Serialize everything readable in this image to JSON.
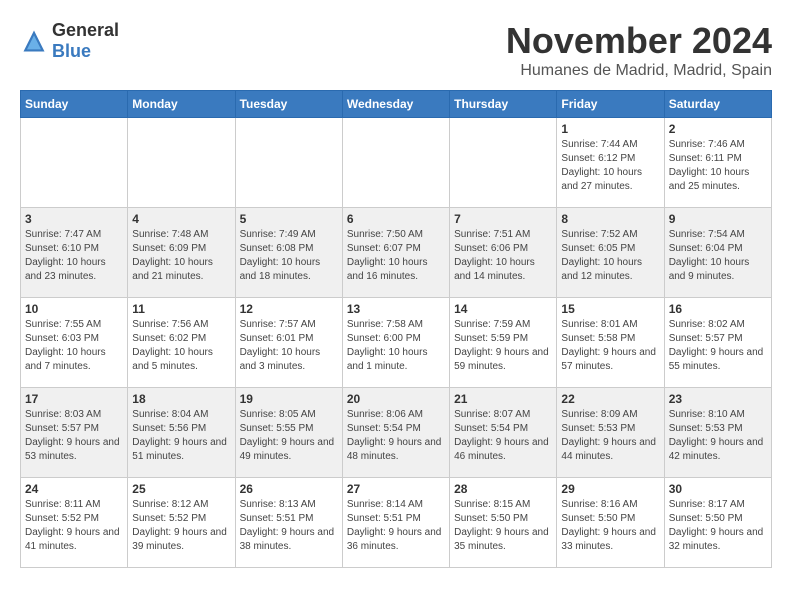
{
  "header": {
    "logo_general": "General",
    "logo_blue": "Blue",
    "title": "November 2024",
    "subtitle": "Humanes de Madrid, Madrid, Spain"
  },
  "weekdays": [
    "Sunday",
    "Monday",
    "Tuesday",
    "Wednesday",
    "Thursday",
    "Friday",
    "Saturday"
  ],
  "weeks": [
    [
      {
        "day": "",
        "sunrise": "",
        "sunset": "",
        "daylight": ""
      },
      {
        "day": "",
        "sunrise": "",
        "sunset": "",
        "daylight": ""
      },
      {
        "day": "",
        "sunrise": "",
        "sunset": "",
        "daylight": ""
      },
      {
        "day": "",
        "sunrise": "",
        "sunset": "",
        "daylight": ""
      },
      {
        "day": "",
        "sunrise": "",
        "sunset": "",
        "daylight": ""
      },
      {
        "day": "1",
        "sunrise": "Sunrise: 7:44 AM",
        "sunset": "Sunset: 6:12 PM",
        "daylight": "Daylight: 10 hours and 27 minutes."
      },
      {
        "day": "2",
        "sunrise": "Sunrise: 7:46 AM",
        "sunset": "Sunset: 6:11 PM",
        "daylight": "Daylight: 10 hours and 25 minutes."
      }
    ],
    [
      {
        "day": "3",
        "sunrise": "Sunrise: 7:47 AM",
        "sunset": "Sunset: 6:10 PM",
        "daylight": "Daylight: 10 hours and 23 minutes."
      },
      {
        "day": "4",
        "sunrise": "Sunrise: 7:48 AM",
        "sunset": "Sunset: 6:09 PM",
        "daylight": "Daylight: 10 hours and 21 minutes."
      },
      {
        "day": "5",
        "sunrise": "Sunrise: 7:49 AM",
        "sunset": "Sunset: 6:08 PM",
        "daylight": "Daylight: 10 hours and 18 minutes."
      },
      {
        "day": "6",
        "sunrise": "Sunrise: 7:50 AM",
        "sunset": "Sunset: 6:07 PM",
        "daylight": "Daylight: 10 hours and 16 minutes."
      },
      {
        "day": "7",
        "sunrise": "Sunrise: 7:51 AM",
        "sunset": "Sunset: 6:06 PM",
        "daylight": "Daylight: 10 hours and 14 minutes."
      },
      {
        "day": "8",
        "sunrise": "Sunrise: 7:52 AM",
        "sunset": "Sunset: 6:05 PM",
        "daylight": "Daylight: 10 hours and 12 minutes."
      },
      {
        "day": "9",
        "sunrise": "Sunrise: 7:54 AM",
        "sunset": "Sunset: 6:04 PM",
        "daylight": "Daylight: 10 hours and 9 minutes."
      }
    ],
    [
      {
        "day": "10",
        "sunrise": "Sunrise: 7:55 AM",
        "sunset": "Sunset: 6:03 PM",
        "daylight": "Daylight: 10 hours and 7 minutes."
      },
      {
        "day": "11",
        "sunrise": "Sunrise: 7:56 AM",
        "sunset": "Sunset: 6:02 PM",
        "daylight": "Daylight: 10 hours and 5 minutes."
      },
      {
        "day": "12",
        "sunrise": "Sunrise: 7:57 AM",
        "sunset": "Sunset: 6:01 PM",
        "daylight": "Daylight: 10 hours and 3 minutes."
      },
      {
        "day": "13",
        "sunrise": "Sunrise: 7:58 AM",
        "sunset": "Sunset: 6:00 PM",
        "daylight": "Daylight: 10 hours and 1 minute."
      },
      {
        "day": "14",
        "sunrise": "Sunrise: 7:59 AM",
        "sunset": "Sunset: 5:59 PM",
        "daylight": "Daylight: 9 hours and 59 minutes."
      },
      {
        "day": "15",
        "sunrise": "Sunrise: 8:01 AM",
        "sunset": "Sunset: 5:58 PM",
        "daylight": "Daylight: 9 hours and 57 minutes."
      },
      {
        "day": "16",
        "sunrise": "Sunrise: 8:02 AM",
        "sunset": "Sunset: 5:57 PM",
        "daylight": "Daylight: 9 hours and 55 minutes."
      }
    ],
    [
      {
        "day": "17",
        "sunrise": "Sunrise: 8:03 AM",
        "sunset": "Sunset: 5:57 PM",
        "daylight": "Daylight: 9 hours and 53 minutes."
      },
      {
        "day": "18",
        "sunrise": "Sunrise: 8:04 AM",
        "sunset": "Sunset: 5:56 PM",
        "daylight": "Daylight: 9 hours and 51 minutes."
      },
      {
        "day": "19",
        "sunrise": "Sunrise: 8:05 AM",
        "sunset": "Sunset: 5:55 PM",
        "daylight": "Daylight: 9 hours and 49 minutes."
      },
      {
        "day": "20",
        "sunrise": "Sunrise: 8:06 AM",
        "sunset": "Sunset: 5:54 PM",
        "daylight": "Daylight: 9 hours and 48 minutes."
      },
      {
        "day": "21",
        "sunrise": "Sunrise: 8:07 AM",
        "sunset": "Sunset: 5:54 PM",
        "daylight": "Daylight: 9 hours and 46 minutes."
      },
      {
        "day": "22",
        "sunrise": "Sunrise: 8:09 AM",
        "sunset": "Sunset: 5:53 PM",
        "daylight": "Daylight: 9 hours and 44 minutes."
      },
      {
        "day": "23",
        "sunrise": "Sunrise: 8:10 AM",
        "sunset": "Sunset: 5:53 PM",
        "daylight": "Daylight: 9 hours and 42 minutes."
      }
    ],
    [
      {
        "day": "24",
        "sunrise": "Sunrise: 8:11 AM",
        "sunset": "Sunset: 5:52 PM",
        "daylight": "Daylight: 9 hours and 41 minutes."
      },
      {
        "day": "25",
        "sunrise": "Sunrise: 8:12 AM",
        "sunset": "Sunset: 5:52 PM",
        "daylight": "Daylight: 9 hours and 39 minutes."
      },
      {
        "day": "26",
        "sunrise": "Sunrise: 8:13 AM",
        "sunset": "Sunset: 5:51 PM",
        "daylight": "Daylight: 9 hours and 38 minutes."
      },
      {
        "day": "27",
        "sunrise": "Sunrise: 8:14 AM",
        "sunset": "Sunset: 5:51 PM",
        "daylight": "Daylight: 9 hours and 36 minutes."
      },
      {
        "day": "28",
        "sunrise": "Sunrise: 8:15 AM",
        "sunset": "Sunset: 5:50 PM",
        "daylight": "Daylight: 9 hours and 35 minutes."
      },
      {
        "day": "29",
        "sunrise": "Sunrise: 8:16 AM",
        "sunset": "Sunset: 5:50 PM",
        "daylight": "Daylight: 9 hours and 33 minutes."
      },
      {
        "day": "30",
        "sunrise": "Sunrise: 8:17 AM",
        "sunset": "Sunset: 5:50 PM",
        "daylight": "Daylight: 9 hours and 32 minutes."
      }
    ]
  ]
}
